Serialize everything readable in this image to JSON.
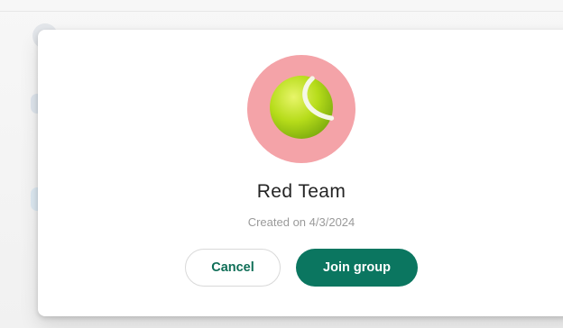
{
  "dialog": {
    "avatar_icon": "tennis-ball-icon",
    "avatar_bg_color": "#f4a3a8",
    "group_name": "Red Team",
    "created_text": "Created on 4/3/2024",
    "buttons": {
      "cancel_label": "Cancel",
      "join_label": "Join group"
    },
    "colors": {
      "primary": "#0b7660",
      "cancel_text": "#0f6e57"
    }
  }
}
